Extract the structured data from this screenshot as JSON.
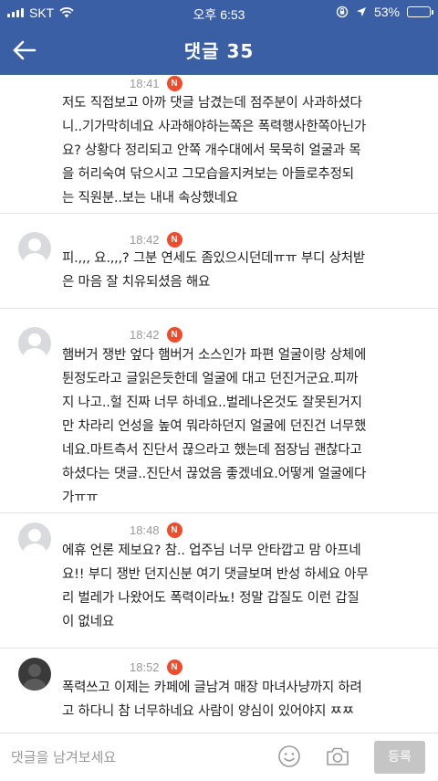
{
  "status_bar": {
    "carrier": "SKT",
    "time": "오후 6:53",
    "battery": "53%",
    "battery_level": 0.53
  },
  "header": {
    "title": "댓글 35",
    "back_icon": "back-arrow-icon"
  },
  "comments": [
    {
      "time": "18:41",
      "badge": "N",
      "lines": [
        "저도 직접보고 아까 댓글 남겼는데 점주분이 사과하셨다",
        "니..기가막히네요 사과해야하는쪽은 폭력행사한쪽아닌가",
        "요? 상황다 정리되고 안쪽 개수대에서 묵묵히 얼굴과 목",
        "을 허리숙여 닦으시고 그모습을지켜보는 아들로추정되",
        "는 직원분..보는 내내 속상했네요"
      ]
    },
    {
      "time": "18:42",
      "badge": "N",
      "lines": [
        "피.,,, 요.,,,?  그분 연세도 좀있으시던데ㅠㅠ 부디 상처받",
        "은 마음 잘 치유되셨음 해요"
      ]
    },
    {
      "time": "18:42",
      "badge": "N",
      "lines": [
        "햄버거 쟁반 엎다 햄버거 소스인가 파편 얼굴이랑 상체에",
        "튄정도라고 글읽은듯한데 얼굴에 대고 던진거군요.피까",
        "지 나고..헐 진짜 너무 하네요..벌레나온것도 잘못된거지",
        "만 차라리 언성을 높여 뭐라하던지 얼굴에 던진건 너무했",
        "네요.마트측서 진단서 끊으라고 했는데 점장님 괜찮다고",
        "하셨다는 댓글..진단서 끊었음 좋겠네요.어떻게 얼굴에다",
        "가ㅠㅠ"
      ]
    },
    {
      "time": "18:48",
      "badge": "N",
      "lines": [
        "에휴 언론 제보요? 참.. 업주님 너무 안타깝고 맘 아프네",
        "요!! 부디 쟁반 던지신분 여기 댓글보며 반성 하세요 아무",
        "리 벌레가 나왔어도 폭력이라뇨! 정말 갑질도 이런 갑질",
        "이 없네요"
      ]
    },
    {
      "time": "18:52",
      "badge": "N",
      "lines": [
        "폭력쓰고 이제는 카페에 글남겨 매장 마녀사냥까지 하려",
        "고 하다니 참 너무하네요  사람이  양심이 있어야지 ㅉㅉ"
      ]
    }
  ],
  "input_bar": {
    "placeholder": "댓글을 남겨보세요",
    "submit_label": "등록",
    "emoji_icon": "emoji-icon",
    "camera_icon": "camera-icon"
  }
}
